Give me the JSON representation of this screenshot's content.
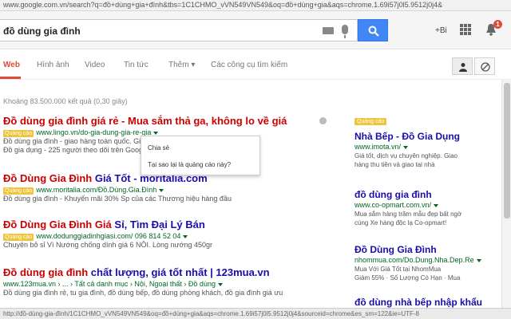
{
  "browser": {
    "url": "www.google.com.vn/search?q=đồ+dùng+gia+đình&tbs=1C1CHMO_vVN549VN549&oq=đồ+dùng+gia&aqs=chrome.1.69i57j0l5.9512j0j4&",
    "status_url": "http://đồ-dùng-gia-đình/1C1CHMO_vVN549VN549&oq=đồ+dùng+gia&aqs=chrome.1.69i57j0l5.9512j0j4&sourceid=chrome&es_sm=122&ie=UTF-8"
  },
  "header": {
    "query": "đồ dùng gia đình",
    "user": "+Bi",
    "notification_count": "1",
    "search_button_color": "#4285f4",
    "icons": [
      "keyboard-icon",
      "microphone-icon",
      "search-icon",
      "apps-icon",
      "bell-icon"
    ]
  },
  "tabs": [
    {
      "label": "Web",
      "active": true
    },
    {
      "label": "Hình ảnh"
    },
    {
      "label": "Video"
    },
    {
      "label": "Tin tức"
    },
    {
      "label": "Thêm ▾"
    },
    {
      "label": "Các công cụ tìm kiếm"
    }
  ],
  "stats": "Khoảng 83.500.000 kết quả (0,30 giây)",
  "ad_menu": {
    "items": [
      "Chia sẻ",
      "Tại sao lại là quảng cáo này?"
    ]
  },
  "results": [
    {
      "title_hl": "Đồ dùng gia đình giá",
      "title_rest": " rẻ - Mua sắm thả ga, không lo về giá",
      "cite": "www.lingo.vn/do-gia-dung-gia-re-gia",
      "snippet1": "Đồ dùng gia đình - giao hàng toàn quốc. Giảm giá đến 70%",
      "snippet2": "Đồ gia dụng - 225 người theo dõi trên Google+"
    },
    {
      "title_hl": "Đồ Dùng Gia Đình",
      "title_rest": " Giá Tốt - moritalia.com",
      "cite": "www.moritalia.com/Đồ.Dùng.Gia.Đình",
      "snippet1": "Đồ dùng gia đình - Khuyến mãi 30% Sp của các Thương hiệu hàng đầu",
      "snippet2": ""
    },
    {
      "title_hl": "Đồ Dùng Gia Đình Giá",
      "title_rest": " Sỉ, Tìm Đại Lý Bán",
      "cite": "www.dodunggiadinhgiasi.com/   096 814 52 04",
      "snippet1": "Chuyên bỏ sỉ Vì Nướng chống dính giá 6 NỒI. Lòng nướng 450gr",
      "snippet2": ""
    },
    {
      "title_hl": "Đồ dùng gia đình",
      "title_rest": " chất lượng, giá tốt nhất | 123mua.vn",
      "cite": "www.123mua.vn › ... › Tất cả danh mục › Nội, Ngoại thất › Đồ dùng",
      "snippet1": "Đồ dùng gia đình rẻ, tu gia đình, đồ dùng bếp, đồ dùng phòng khách, đồ gia đình giá ưu",
      "snippet2": ""
    }
  ],
  "sidebar": {
    "badge": "Quảng cáo",
    "ads": [
      {
        "title": "Nhà Bếp - Đồ Gia Dụng",
        "cite": "www.imota.vn/",
        "snippet1": "Giá tốt, dịch vụ chuyên nghiệp. Giao",
        "snippet2": "hàng thu tiền và giao tại nhà"
      },
      {
        "title": "đồ dùng gia đình",
        "cite": "www.co-opmart.com.vn/",
        "snippet1": "Mua sắm hàng trăm mẫu đẹp bất ngờ",
        "snippet2": "cùng Xe hàng độc lạ Co-opmart!"
      },
      {
        "title": "Đồ Dùng Gia Đình",
        "cite": "nhommua.com/Do.Dung.Nha.Dep.Re",
        "snippet1": "Mua Với Giá Tốt tại NhomMua",
        "snippet2": "Giảm 55% · Số Lượng Có Hạn · Mua"
      },
      {
        "title": "đồ dùng nhà bếp nhập khẩu",
        "cite": "",
        "snippet1": "",
        "snippet2": ""
      }
    ]
  }
}
